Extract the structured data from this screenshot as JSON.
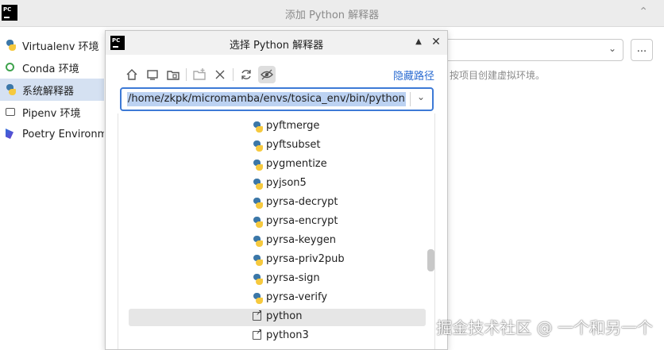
{
  "outer_window": {
    "title": "添加 Python 解释器",
    "logo_text": "PC"
  },
  "sidebar": {
    "items": [
      {
        "label": "Virtualenv 环境",
        "icon": "python-icon",
        "selected": false
      },
      {
        "label": "Conda 环境",
        "icon": "conda-icon",
        "selected": false
      },
      {
        "label": "系统解释器",
        "icon": "python-icon",
        "selected": true
      },
      {
        "label": "Pipenv 环境",
        "icon": "pipenv-icon",
        "selected": false
      },
      {
        "label": "Poetry Environment",
        "icon": "poetry-icon",
        "selected": false
      }
    ]
  },
  "main_panel": {
    "more_button": "...",
    "hint": "按项目创建虚拟环境。"
  },
  "dialog": {
    "title": "选择 Python 解释器",
    "logo_text": "PC",
    "collapse_glyph": "▲",
    "close_glyph": "✕",
    "hide_path_link": "隐藏路径",
    "toolbar": [
      "home-icon",
      "desktop-icon",
      "project-folder-icon",
      "new-folder-icon",
      "delete-icon",
      "refresh-icon",
      "show-hidden-icon"
    ],
    "path_value": "/home/zkpk/micromamba/envs/tosica_env/bin/python",
    "files": [
      {
        "name": "pyftmerge",
        "icon": "python-icon"
      },
      {
        "name": "pyftsubset",
        "icon": "python-icon"
      },
      {
        "name": "pygmentize",
        "icon": "python-icon"
      },
      {
        "name": "pyjson5",
        "icon": "python-icon"
      },
      {
        "name": "pyrsa-decrypt",
        "icon": "python-icon"
      },
      {
        "name": "pyrsa-encrypt",
        "icon": "python-icon"
      },
      {
        "name": "pyrsa-keygen",
        "icon": "python-icon"
      },
      {
        "name": "pyrsa-priv2pub",
        "icon": "python-icon"
      },
      {
        "name": "pyrsa-sign",
        "icon": "python-icon"
      },
      {
        "name": "pyrsa-verify",
        "icon": "python-icon"
      },
      {
        "name": "python",
        "icon": "symlink-icon",
        "selected": true
      },
      {
        "name": "python3",
        "icon": "symlink-icon"
      }
    ]
  },
  "watermark": "掘金技术社区 @ 一个和另一个",
  "colors": {
    "accent": "#3d7ad6",
    "link": "#2a6bd1",
    "sidebar_selected": "#d5e1f2",
    "path_highlight": "#bcd2f2"
  }
}
